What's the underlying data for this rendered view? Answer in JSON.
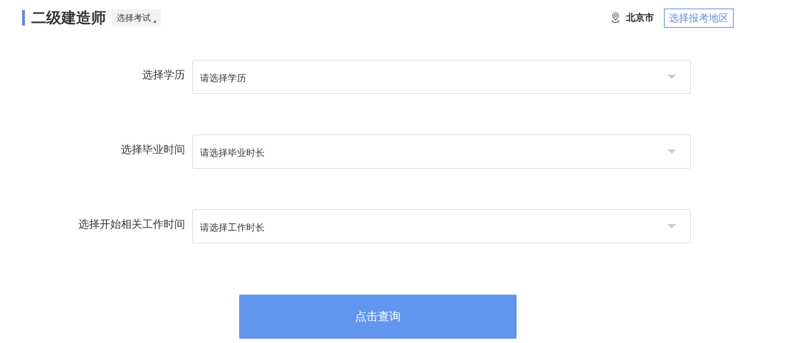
{
  "header": {
    "title": "二级建造师",
    "exam_button": "选择考试",
    "city": "北京市",
    "region_button": "选择报考地区"
  },
  "fields": [
    {
      "label": "选择学历",
      "placeholder": "请选择学历"
    },
    {
      "label": "选择毕业时间",
      "placeholder": "请选择毕业时长"
    },
    {
      "label": "选择开始相关工作时间",
      "placeholder": "请选择工作时长"
    }
  ],
  "submit": "点击查询"
}
